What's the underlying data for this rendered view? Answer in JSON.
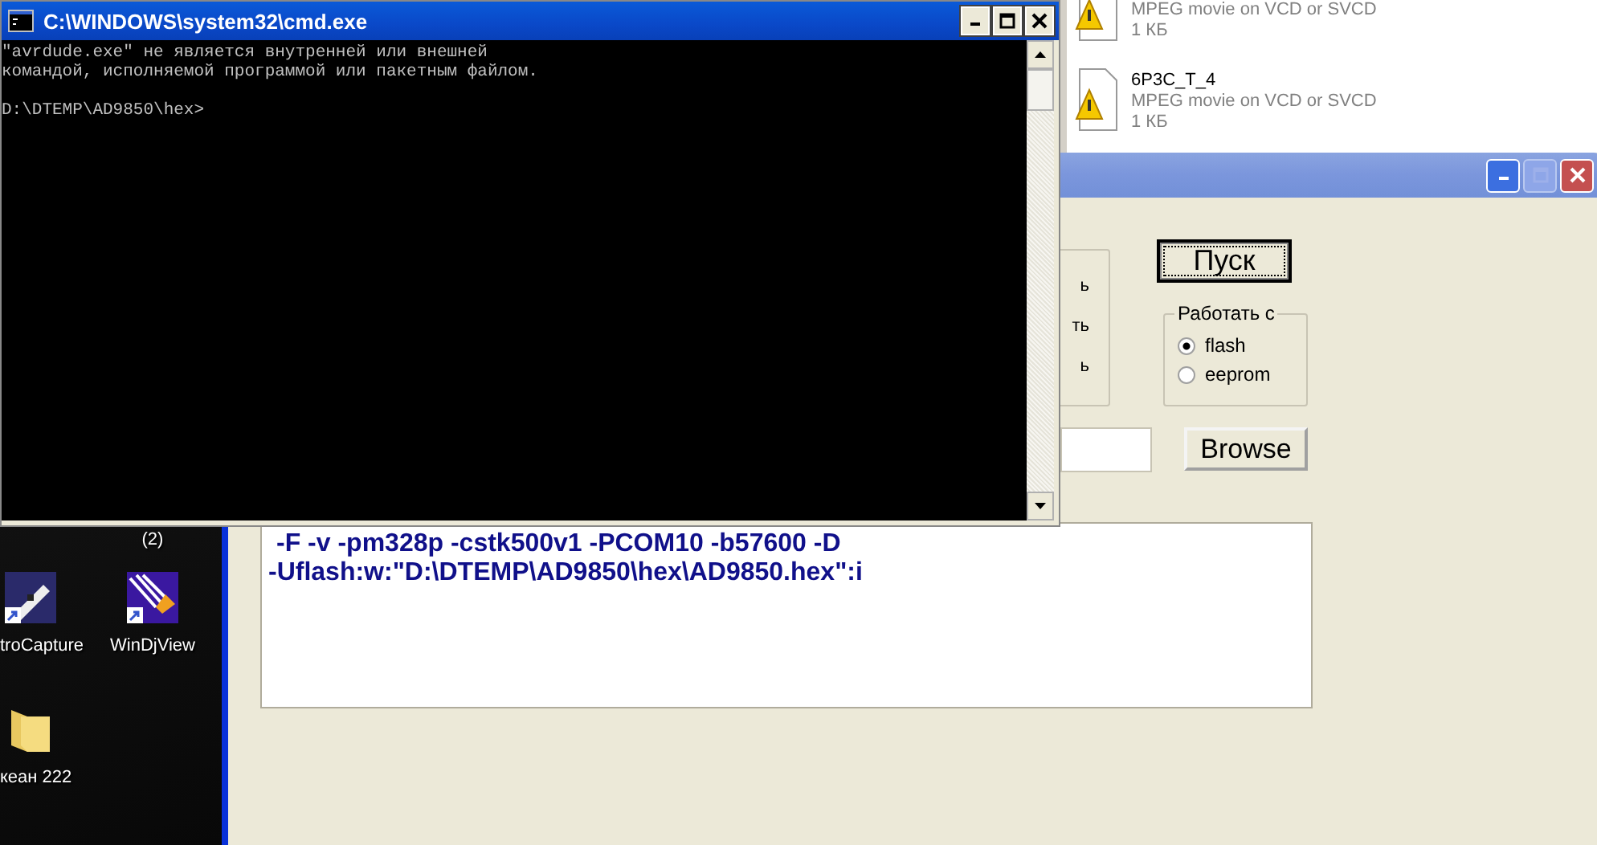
{
  "cmd_window": {
    "title": "C:\\WINDOWS\\system32\\cmd.exe",
    "lines": [
      {
        "kind": "output",
        "text": "\"avrdude.exe\" не является внутренней или внешней"
      },
      {
        "kind": "output",
        "text": "командой, исполняемой программой или пакетным файлом."
      },
      {
        "kind": "prompt",
        "text": "D:\\DTEMP\\AD9850\\hex>"
      }
    ]
  },
  "explorer_files": [
    {
      "type": "MPEG movie on VCD or SVCD",
      "size": "1 КБ"
    },
    {
      "name": "6P3C_T_4",
      "type": "MPEG movie on VCD or SVCD",
      "size": "1 КБ"
    }
  ],
  "desktop_icons": [
    {
      "kind": "hidden",
      "label": "(2)"
    },
    {
      "kind": "capture",
      "label": "troCapture"
    },
    {
      "kind": "djview",
      "label": "WinDjView"
    },
    {
      "kind": "folder",
      "label": "кеан 222"
    }
  ],
  "app_window": {
    "maximize_disabled": true,
    "group_fragments": [
      "ь",
      "ть",
      "ь"
    ],
    "start_button": {
      "label": "Пуск",
      "focused": true
    },
    "mode_group": {
      "label": "Работать с",
      "options": [
        {
          "label": "flash",
          "selected": true
        },
        {
          "label": "eeprom",
          "selected": false
        }
      ]
    },
    "browse_button": "Browse",
    "command_lines": [
      "-F -v -pm328p -cstk500v1 -PCOM10 -b57600 -D",
      "-Uflash:w:\"D:\\DTEMP\\AD9850\\hex\\AD9850.hex\":i"
    ]
  }
}
